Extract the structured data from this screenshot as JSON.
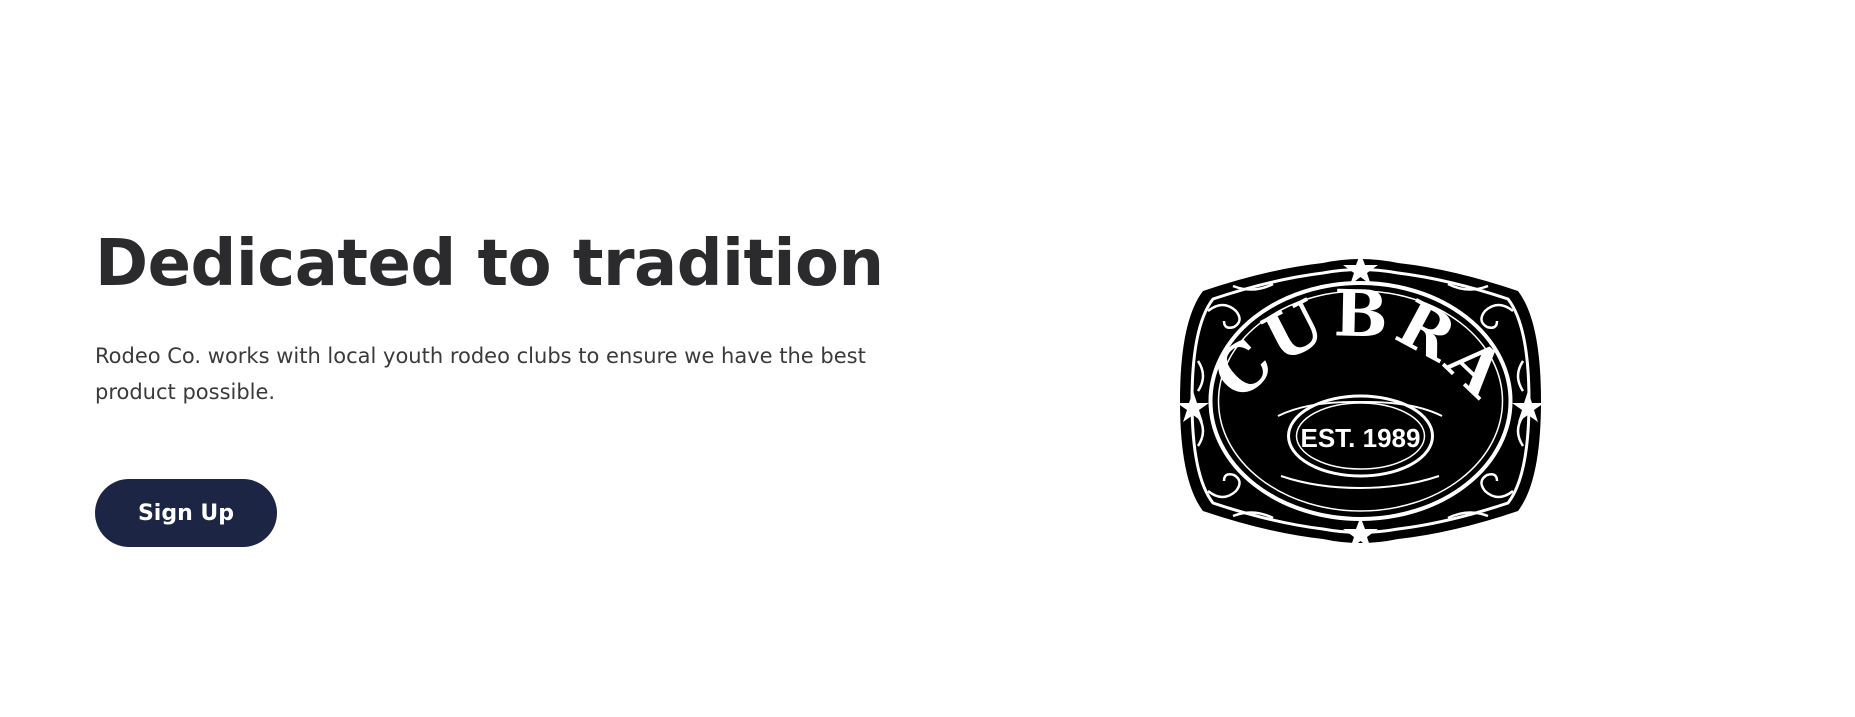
{
  "hero": {
    "title": "Dedicated to tradition",
    "description": "Rodeo Co. works with local youth rodeo clubs to ensure we have the best product possible.",
    "signup_label": "Sign Up"
  },
  "logo": {
    "wordmark": "CUBRA",
    "established": "EST. 1989"
  },
  "colors": {
    "button_bg": "#1c2544",
    "text": "#2b2b2d",
    "logo_black": "#000000",
    "logo_white": "#ffffff"
  },
  "icons": {
    "logo": "belt-buckle-logo",
    "stars": "star-icon"
  }
}
